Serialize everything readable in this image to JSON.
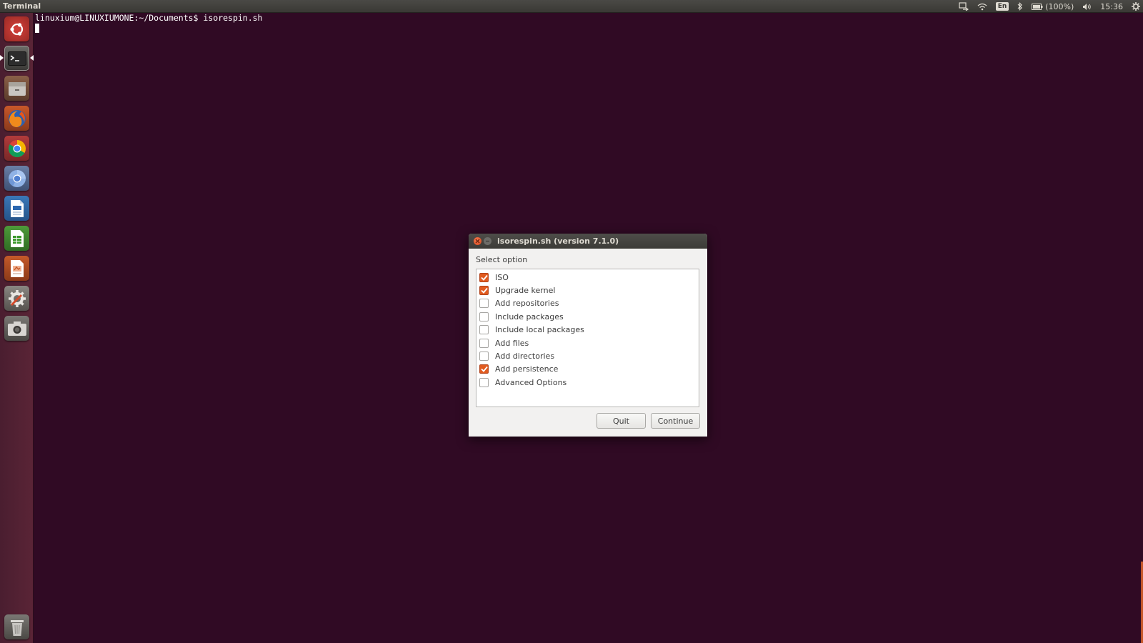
{
  "top_panel": {
    "app_title": "Terminal",
    "tray": {
      "language": "En",
      "battery": "(100%)",
      "clock": "15:36",
      "icons": [
        "transfer-icon",
        "wifi-icon",
        "keyboard-icon",
        "bluetooth-icon",
        "battery-icon",
        "volume-icon",
        "gear-icon"
      ]
    }
  },
  "launcher": {
    "items": [
      {
        "name": "dash-home-icon"
      },
      {
        "name": "terminal-icon",
        "active": true
      },
      {
        "name": "files-icon"
      },
      {
        "name": "firefox-icon"
      },
      {
        "name": "chrome-icon"
      },
      {
        "name": "chromium-icon"
      },
      {
        "name": "writer-icon"
      },
      {
        "name": "calc-icon"
      },
      {
        "name": "impress-icon"
      },
      {
        "name": "settings-icon"
      },
      {
        "name": "camera-icon"
      },
      {
        "name": "trash-icon"
      }
    ]
  },
  "terminal": {
    "prompt": "linuxium@LINUXIUMONE:~/Documents$ isorespin.sh"
  },
  "dialog": {
    "title": "isorespin.sh (version 7.1.0)",
    "prompt_label": "Select option",
    "options": [
      {
        "label": "ISO",
        "checked": true
      },
      {
        "label": "Upgrade kernel",
        "checked": true
      },
      {
        "label": "Add repositories",
        "checked": false
      },
      {
        "label": "Include packages",
        "checked": false
      },
      {
        "label": "Include local packages",
        "checked": false
      },
      {
        "label": "Add files",
        "checked": false
      },
      {
        "label": "Add directories",
        "checked": false
      },
      {
        "label": "Add persistence",
        "checked": true
      },
      {
        "label": "Advanced Options",
        "checked": false
      }
    ],
    "buttons": {
      "quit": "Quit",
      "continue": "Continue"
    }
  },
  "colors": {
    "terminal_bg": "#300a24",
    "accent": "#e05a1e",
    "launcher_bg": "#4a1e30"
  }
}
